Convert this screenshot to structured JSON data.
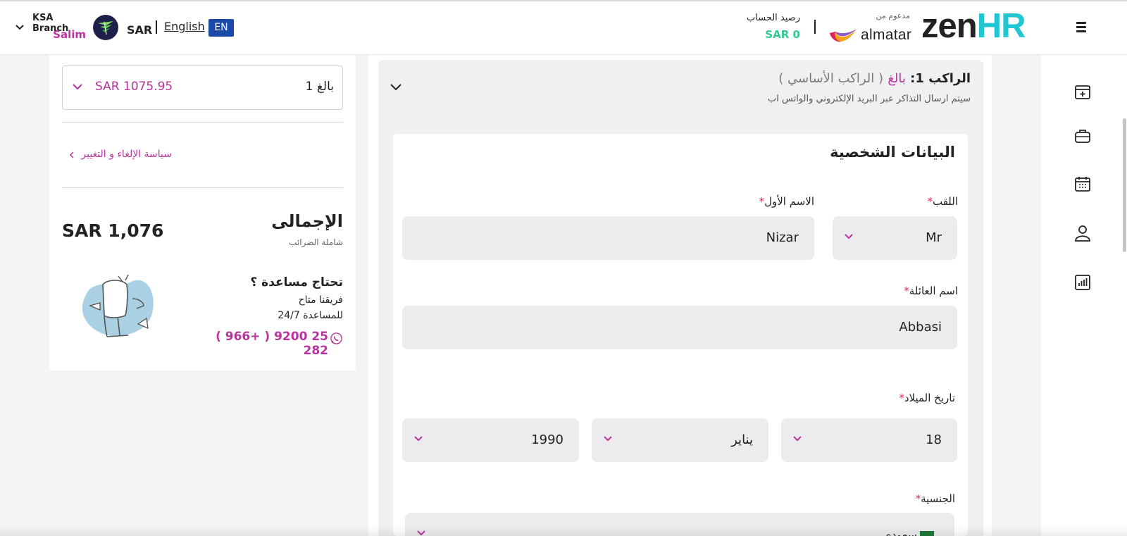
{
  "header": {
    "logo_zen": "zen",
    "logo_hr": "HR",
    "powered_by": "مدعوم من",
    "partner_name": "almatar",
    "balance_label": "رصيد الحساب",
    "balance_value": "SAR 0",
    "language_code": "EN",
    "language_name": "English",
    "currency": "SAR",
    "branch_name": "KSA Branch",
    "user_name": "Salim"
  },
  "rail": {
    "icons": [
      "add-booking-icon",
      "briefcase-icon",
      "calendar-icon",
      "user-icon",
      "reports-icon"
    ]
  },
  "summary": {
    "adult_label": "1 بالغ",
    "adult_price": "SAR 1075.95",
    "policy_link": "سياسة الإلغاء و التغيير",
    "total_label": "الإجمالى",
    "total_sub": "شاملة الضرائب",
    "total_value": "SAR 1,076",
    "help_title": "تحتاج مساعدة ؟",
    "help_line1": "فريقنا متاح",
    "help_line2": "للمساعدة 24/7",
    "help_phone": "( 966+ ) 9200 25 282"
  },
  "passenger": {
    "title_prefix": "الراكب 1:",
    "title_type": "بالغ",
    "title_note": "( الراكب الأساسي )",
    "subtitle": "سيتم ارسال التذاكر عبر البريد الإلكتروني والواتس اب",
    "section_title": "البيانات الشخصية",
    "title_label": "اللقب",
    "title_value": "Mr",
    "first_name_label": "الاسم الأول",
    "first_name_value": "Nizar",
    "last_name_label": "اسم العائلة",
    "last_name_value": "Abbasi",
    "dob_label": "تاريخ الميلاد ",
    "dob_day": "18",
    "dob_month": "يناير",
    "dob_year": "1990",
    "nationality_label": "الجنسية",
    "nationality_value": "سعودي",
    "required_mark": "*"
  },
  "colors": {
    "accent": "#b8339c",
    "balance": "#2ecc8f",
    "brand_hr": "#20c7d1",
    "lang_badge": "#1b49a8"
  }
}
